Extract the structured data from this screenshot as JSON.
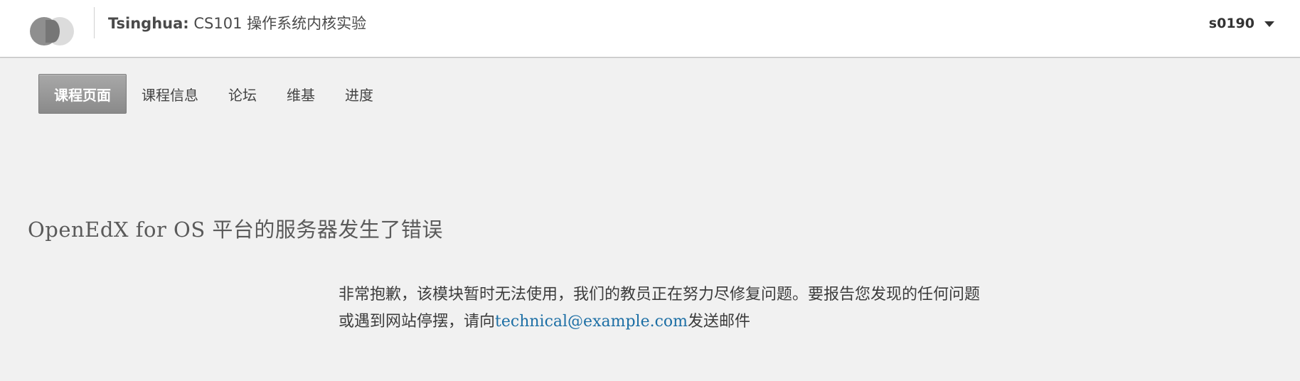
{
  "header": {
    "org": "Tsinghua:",
    "course": "CS101 操作系统内核实验",
    "username": "s0190",
    "logo_icon": "openedx-logo-icon",
    "menu_icon": "caret-down-icon"
  },
  "tabs": [
    {
      "label": "课程页面",
      "active": true
    },
    {
      "label": "课程信息",
      "active": false
    },
    {
      "label": "论坛",
      "active": false
    },
    {
      "label": "维基",
      "active": false
    },
    {
      "label": "进度",
      "active": false
    }
  ],
  "error": {
    "title": "OpenEdX for OS 平台的服务器发生了错误",
    "message_before": "非常抱歉，该模块暂时无法使用，我们的教员正在努力尽修复问题。要报告您发现的任何问题或遇到网站停摆，请向",
    "email": "technical@example.com",
    "message_after": "发送邮件"
  },
  "colors": {
    "background": "#f1f1f1",
    "active_tab": "#9a9a9a",
    "link": "#1d6fa5"
  }
}
